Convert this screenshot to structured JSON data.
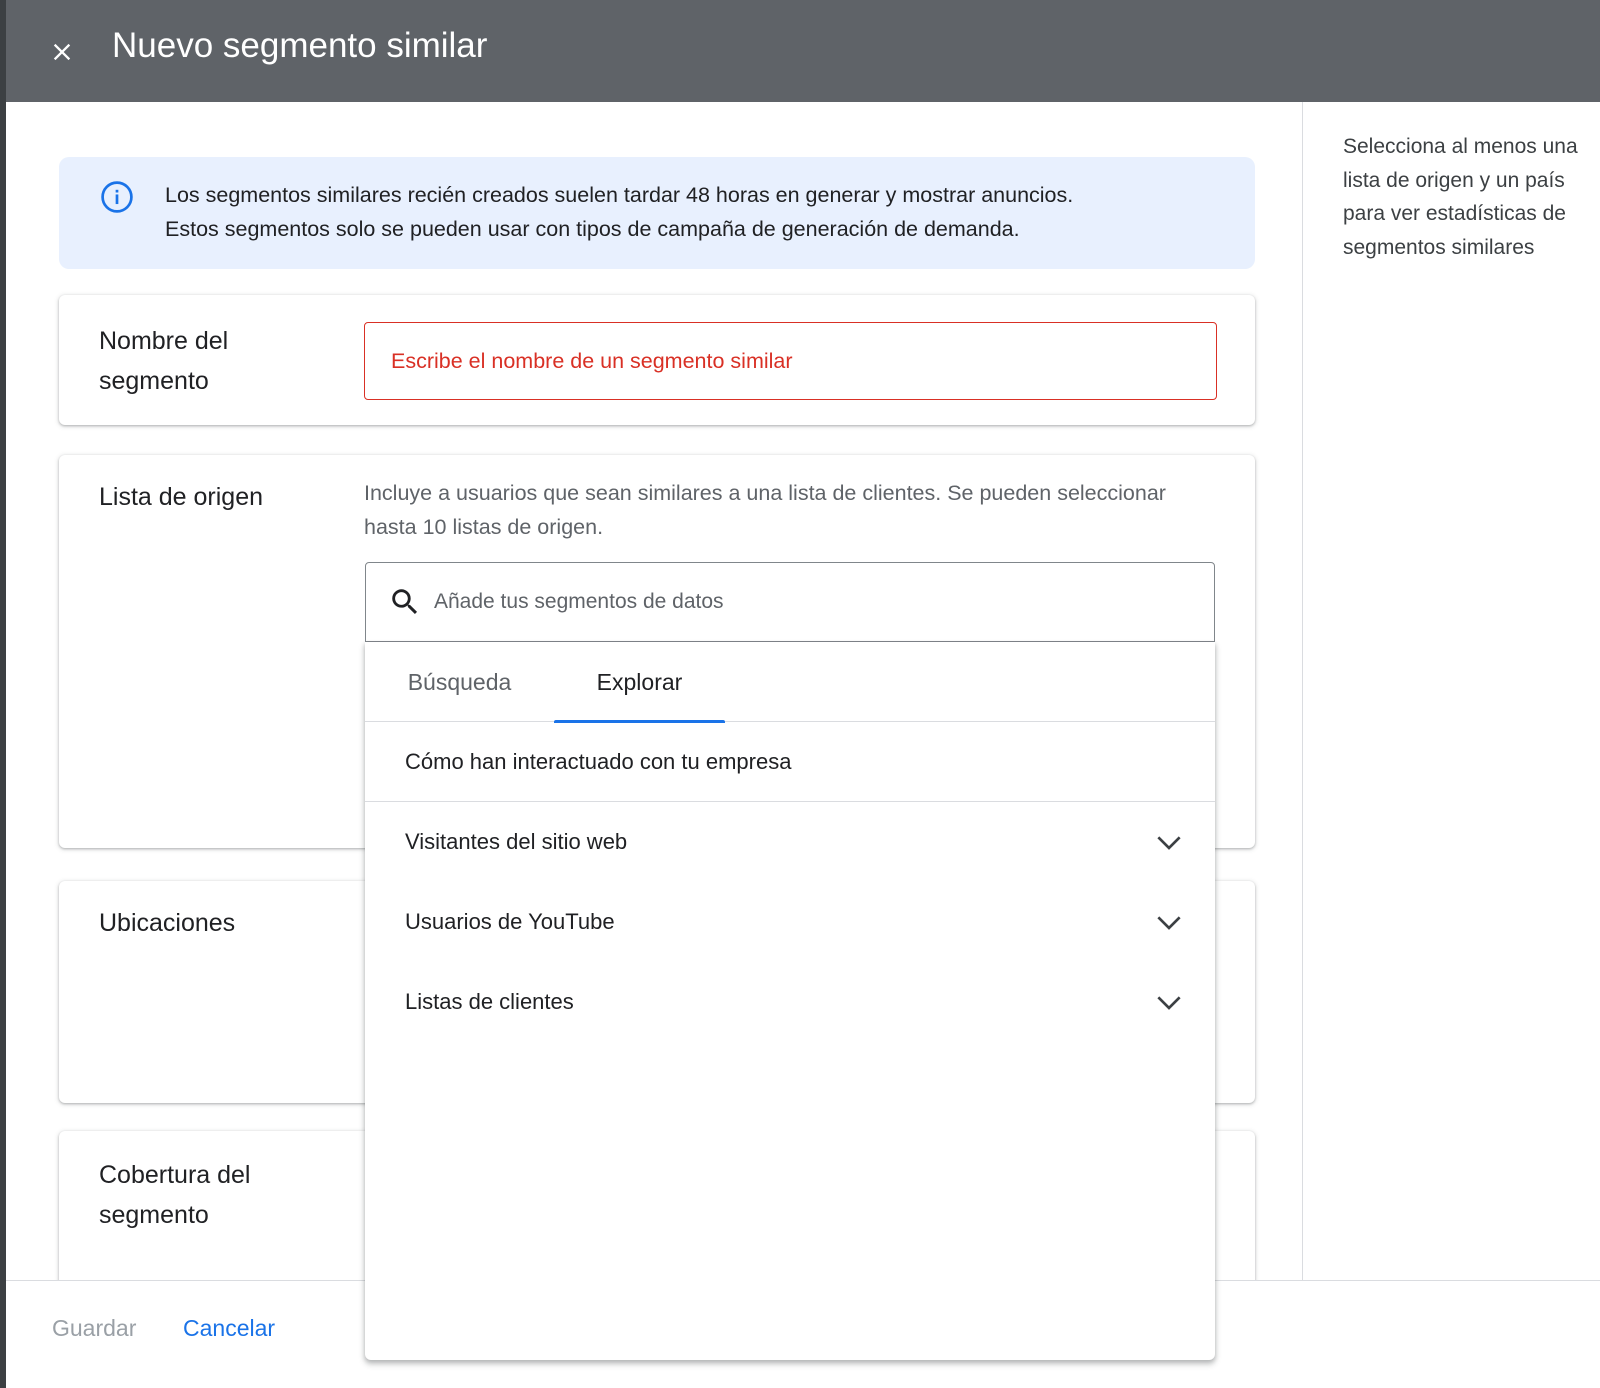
{
  "header": {
    "title": "Nuevo segmento similar"
  },
  "info": {
    "line1": "Los segmentos similares recién creados suelen tardar 48 horas en generar y mostrar anuncios.",
    "line2": "Estos segmentos solo se pueden usar con tipos de campaña de generación de demanda."
  },
  "name_section": {
    "label": "Nombre del segmento",
    "error_placeholder": "Escribe el nombre de un segmento similar"
  },
  "source_section": {
    "label": "Lista de origen",
    "description": "Incluye a usuarios que sean similares a una lista de clientes. Se pueden seleccionar hasta 10 listas de origen.",
    "search_placeholder": "Añade tus segmentos de datos"
  },
  "dropdown": {
    "tabs": [
      "Búsqueda",
      "Explorar"
    ],
    "active_tab": "Explorar",
    "section_title": "Cómo han interactuado con tu empresa",
    "items": [
      "Visitantes del sitio web",
      "Usuarios de YouTube",
      "Listas de clientes"
    ]
  },
  "locations_section": {
    "label": "Ubicaciones"
  },
  "coverage_section": {
    "label": "Cobertura del segmento"
  },
  "side_panel": {
    "text": "Selecciona al menos una lista de origen y un país para ver estadísticas de segmentos similares"
  },
  "footer": {
    "save_label": "Guardar",
    "cancel_label": "Cancelar"
  },
  "colors": {
    "header_bg": "#5f6368",
    "info_bg": "#e8f0fe",
    "accent": "#1a73e8",
    "error": "#d93025"
  }
}
